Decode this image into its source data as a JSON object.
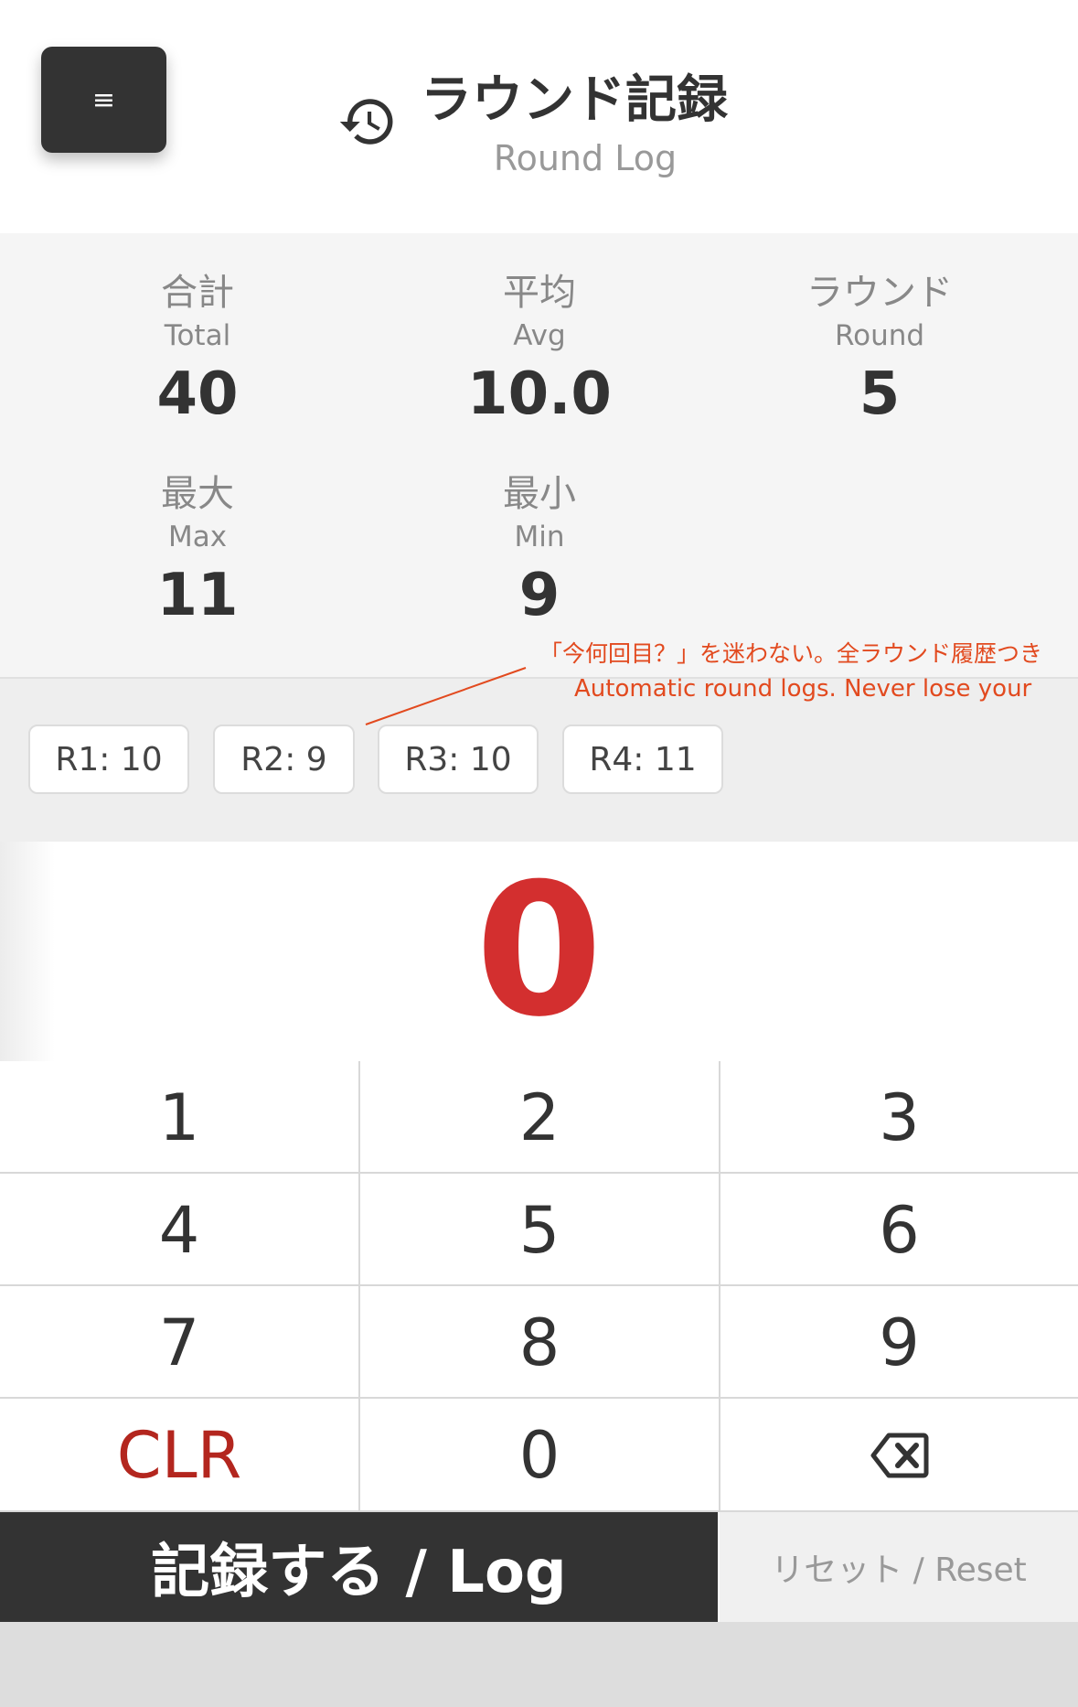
{
  "header": {
    "menu_icon": "≡",
    "history_icon": "history-icon",
    "title_jp": "ラウンド記録",
    "title_en": "Round Log"
  },
  "stats": {
    "total": {
      "jp": "合計",
      "en": "Total",
      "value": "40"
    },
    "avg": {
      "jp": "平均",
      "en": "Avg",
      "value": "10.0"
    },
    "round": {
      "jp": "ラウンド",
      "en": "Round",
      "value": "5"
    },
    "max": {
      "jp": "最大",
      "en": "Max",
      "value": "11"
    },
    "min": {
      "jp": "最小",
      "en": "Min",
      "value": "9"
    }
  },
  "annotation": {
    "jp": "「今何回目？」を迷わない。全ラウンド履歴つき",
    "en": "Automatic round logs. Never lose your",
    "color": "#e24a1f"
  },
  "history": [
    "R1: 10",
    "R2: 9",
    "R3: 10",
    "R4: 11"
  ],
  "display": {
    "value": "0",
    "color": "#d32f2f"
  },
  "keypad": {
    "rows": [
      [
        "1",
        "2",
        "3"
      ],
      [
        "4",
        "5",
        "6"
      ],
      [
        "7",
        "8",
        "9"
      ],
      [
        "CLR",
        "0",
        "backspace-icon"
      ]
    ]
  },
  "actions": {
    "log_label": "記録する / Log",
    "reset_label": "リセット / Reset"
  },
  "colors": {
    "dark": "#333333",
    "accent_red": "#d32f2f"
  }
}
